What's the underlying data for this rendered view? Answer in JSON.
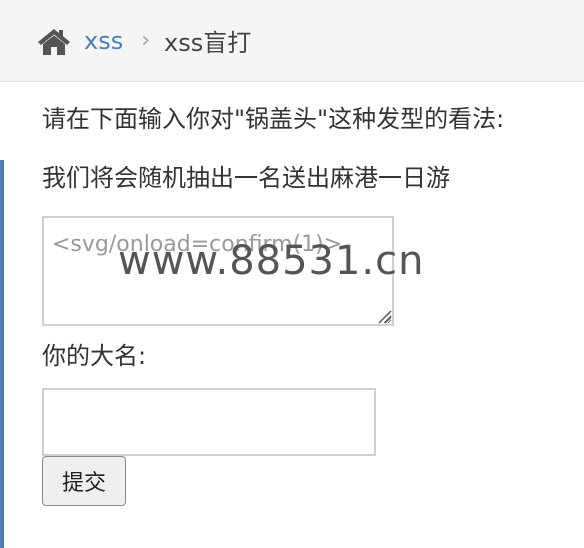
{
  "breadcrumb": {
    "home_icon": "home-icon",
    "link_label": "xss",
    "separator": "›",
    "current_label": "xss盲打"
  },
  "content": {
    "intro_text": "请在下面输入你对\"锅盖头\"这种发型的看法:",
    "prize_text": "我们将会随机抽出一名送出麻港一日游",
    "comment_value": "<svg/onload=confirm(1)>",
    "name_label": "你的大名:",
    "name_value": "",
    "submit_label": "提交"
  },
  "watermark_text": "www.88531.cn",
  "colors": {
    "link": "#4a7fb5",
    "accent_bar": "#4a7fb5",
    "breadcrumb_bg": "#f5f5f5"
  }
}
